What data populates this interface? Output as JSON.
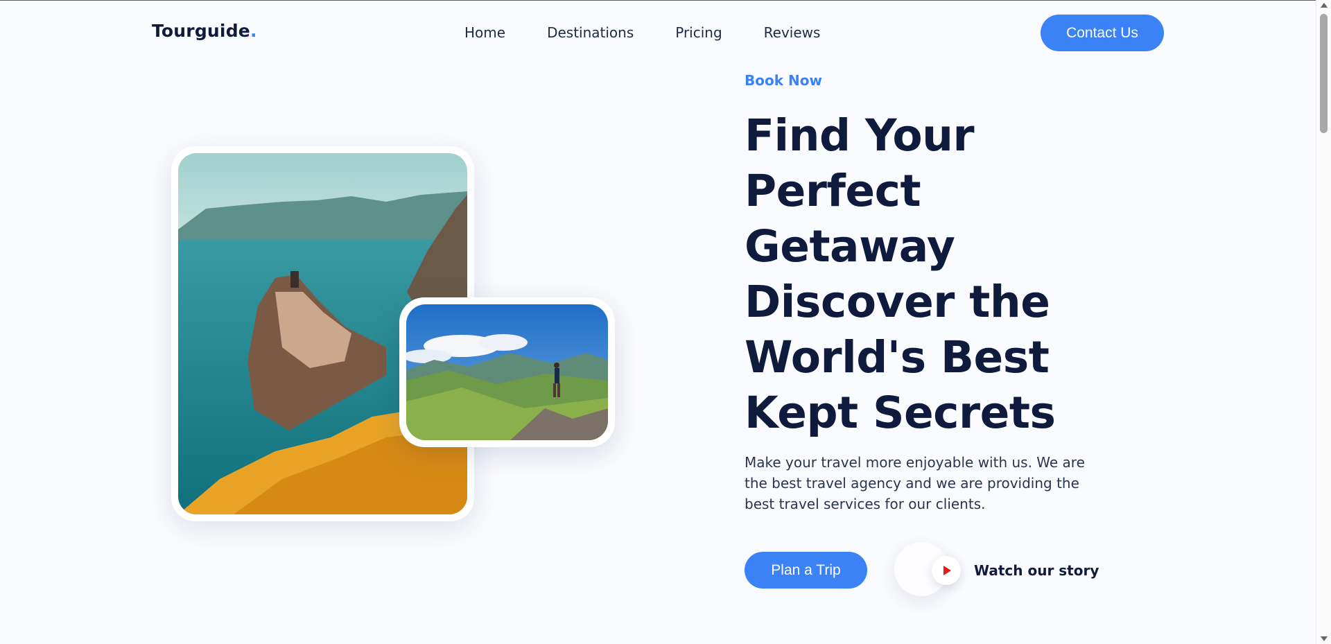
{
  "brand": {
    "name": "Tourguide",
    "dot": "."
  },
  "nav": {
    "items": [
      "Home",
      "Destinations",
      "Pricing",
      "Reviews"
    ],
    "contact_label": "Contact Us"
  },
  "hero": {
    "eyebrow": "Book Now",
    "headline_lines": [
      "Find Your",
      "Perfect",
      "Getaway",
      "Discover the",
      "World's Best",
      "Kept Secrets"
    ],
    "description": "Make your travel more enjoyable with us. We are the best travel agency and we are providing the best travel services for our clients.",
    "primary_cta": "Plan a Trip",
    "secondary_cta": "Watch our story"
  },
  "images": {
    "main": "coastal-cliff-village-photo",
    "secondary": "mountain-hiker-photo"
  },
  "colors": {
    "accent": "#3b82f6",
    "heading": "#0f1b3d",
    "play": "#e11d1d",
    "background": "#fafbfe"
  }
}
